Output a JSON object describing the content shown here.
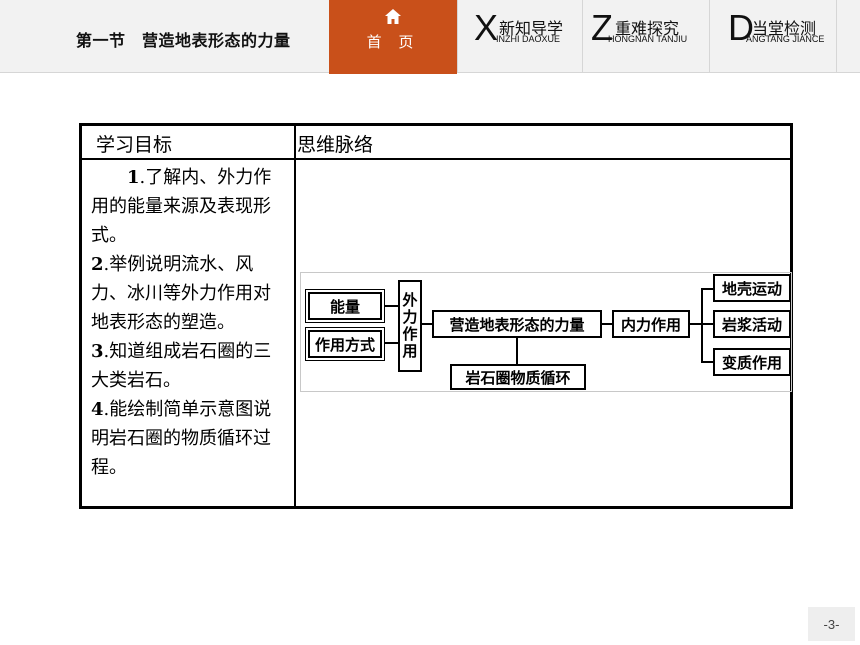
{
  "header": {
    "lesson_title": "第一节　营造地表形态的力量",
    "home": {
      "label": "首 页",
      "icon": "home-icon"
    },
    "tabs": [
      {
        "letter": "X",
        "label": "新知导学",
        "pinyin": "INZHI DAOXUE"
      },
      {
        "letter": "Z",
        "label": "重难探究",
        "pinyin": "HONGNAN TANJIU"
      },
      {
        "letter": "D",
        "label": "当堂检测",
        "pinyin": "ANGTANG JIANCE"
      }
    ]
  },
  "table": {
    "col1_header": "学习目标",
    "col2_header": "思维脉络",
    "objectives": [
      {
        "num": "1",
        "text": ".了解内、外力作用的能量来源及表现形式。"
      },
      {
        "num": "2",
        "text": ".举例说明流水、风力、冰川等外力作用对地表形态的塑造。"
      },
      {
        "num": "3",
        "text": ".知道组成岩石圈的三大类岩石。"
      },
      {
        "num": "4",
        "text": ".能绘制简单示意图说明岩石圈的物质循环过程。"
      }
    ]
  },
  "mindmap": {
    "energy": "能量",
    "mode": "作用方式",
    "external": "外力作用",
    "center": "营造地表形态的力量",
    "internal": "内力作用",
    "rock_cycle": "岩石圈物质循环",
    "outputs": [
      "地壳运动",
      "岩浆活动",
      "变质作用"
    ]
  },
  "footer": {
    "page_number": "-3-"
  }
}
